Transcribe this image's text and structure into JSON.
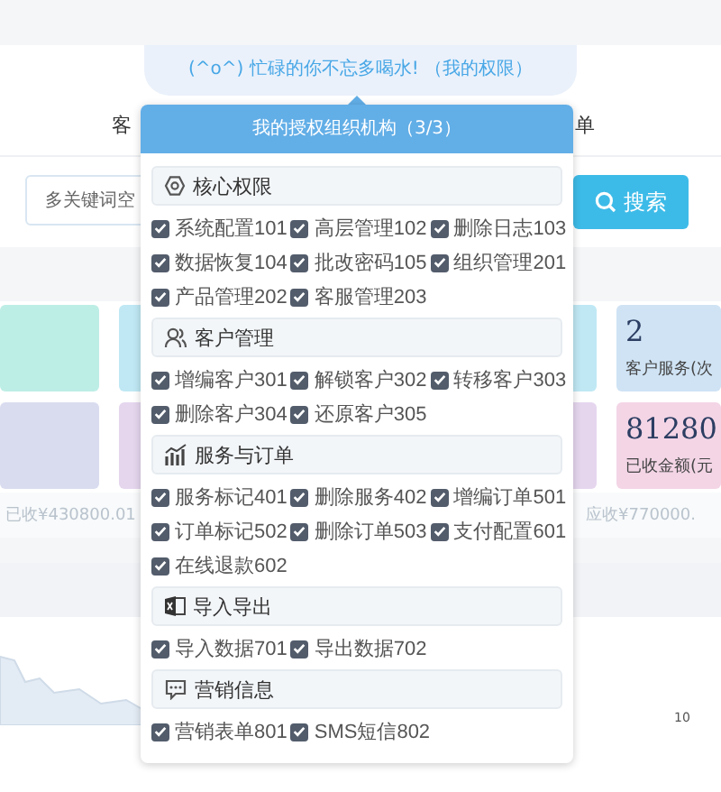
{
  "tip": {
    "message": "(^o^) 忙碌的你不忘多喝水!",
    "link": "（我的权限）"
  },
  "nav": [
    {
      "label": "客"
    },
    {
      "label": "单"
    }
  ],
  "search": {
    "placeholder": "多关键词空",
    "button": "搜索"
  },
  "cards": [
    {
      "color": "#bdeee6"
    },
    {
      "color": "#bfe8f4"
    },
    {
      "value": "2",
      "label": "客户服务(次",
      "color": "#cfe3f4"
    },
    {
      "color": "#d9dcef"
    },
    {
      "color": "#e5d6ee"
    },
    {
      "value": "81280",
      "label": "已收金额(元",
      "color": "#f3d5e6"
    }
  ],
  "summary": [
    "已收¥430800.01",
    "应收¥770000."
  ],
  "map_label": "10",
  "popup": {
    "title": "我的授权组织机构（3/3）",
    "sections": [
      {
        "kind": "gear",
        "title": "核心权限",
        "items": [
          {
            "label": "系统配置101",
            "checked": true
          },
          {
            "label": "高层管理102",
            "checked": true
          },
          {
            "label": "删除日志103",
            "checked": true
          },
          {
            "label": "数据恢复104",
            "checked": true
          },
          {
            "label": "批改密码105",
            "checked": true
          },
          {
            "label": "组织管理201",
            "checked": true
          },
          {
            "label": "产品管理202",
            "checked": true
          },
          {
            "label": "客服管理203",
            "checked": true
          }
        ]
      },
      {
        "kind": "users",
        "title": "客户管理",
        "items": [
          {
            "label": "增编客户301",
            "checked": true
          },
          {
            "label": "解锁客户302",
            "checked": true
          },
          {
            "label": "转移客户303",
            "checked": true
          },
          {
            "label": "删除客户304",
            "checked": true
          },
          {
            "label": "还原客户305",
            "checked": true
          }
        ]
      },
      {
        "kind": "chart",
        "title": "服务与订单",
        "items": [
          {
            "label": "服务标记401",
            "checked": true
          },
          {
            "label": "删除服务402",
            "checked": true
          },
          {
            "label": "增编订单501",
            "checked": true
          },
          {
            "label": "订单标记502",
            "checked": true
          },
          {
            "label": "删除订单503",
            "checked": true
          },
          {
            "label": "支付配置601",
            "checked": true
          },
          {
            "label": "在线退款602",
            "checked": true
          }
        ]
      },
      {
        "kind": "sheet",
        "title": "导入导出",
        "items": [
          {
            "label": "导入数据701",
            "checked": true
          },
          {
            "label": "导出数据702",
            "checked": true
          }
        ]
      },
      {
        "kind": "chat",
        "title": "营销信息",
        "items": [
          {
            "label": "营销表单801",
            "checked": true
          },
          {
            "label": "SMS短信802",
            "checked": true
          }
        ]
      }
    ]
  }
}
